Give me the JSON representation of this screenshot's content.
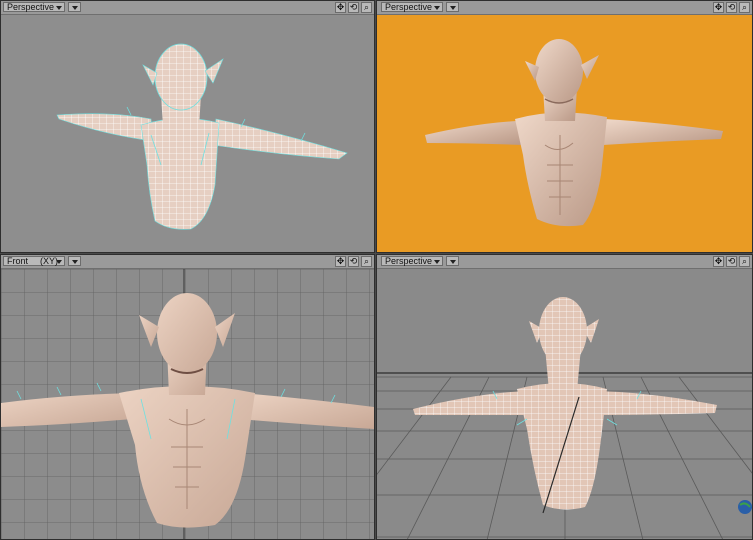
{
  "viewports": [
    {
      "view_label": "Perspective",
      "bg": "#8e8e8e",
      "mode": "wire"
    },
    {
      "view_label": "Perspective",
      "bg": "#e99b24",
      "mode": "shaded"
    },
    {
      "view_label": "Front",
      "axis_label": "(XY)",
      "bg": "#8c8c8c",
      "mode": "front"
    },
    {
      "view_label": "Perspective",
      "bg": "#8a8a8a",
      "mode": "back"
    }
  ],
  "icons": {
    "move": "move-icon",
    "rotate": "rotate-icon",
    "zoom": "zoom-icon"
  },
  "colors": {
    "skin": "#e3c7b4",
    "skin_shadow": "#b99886",
    "wire": "#ffffff",
    "cage": "#5fd8d8"
  }
}
